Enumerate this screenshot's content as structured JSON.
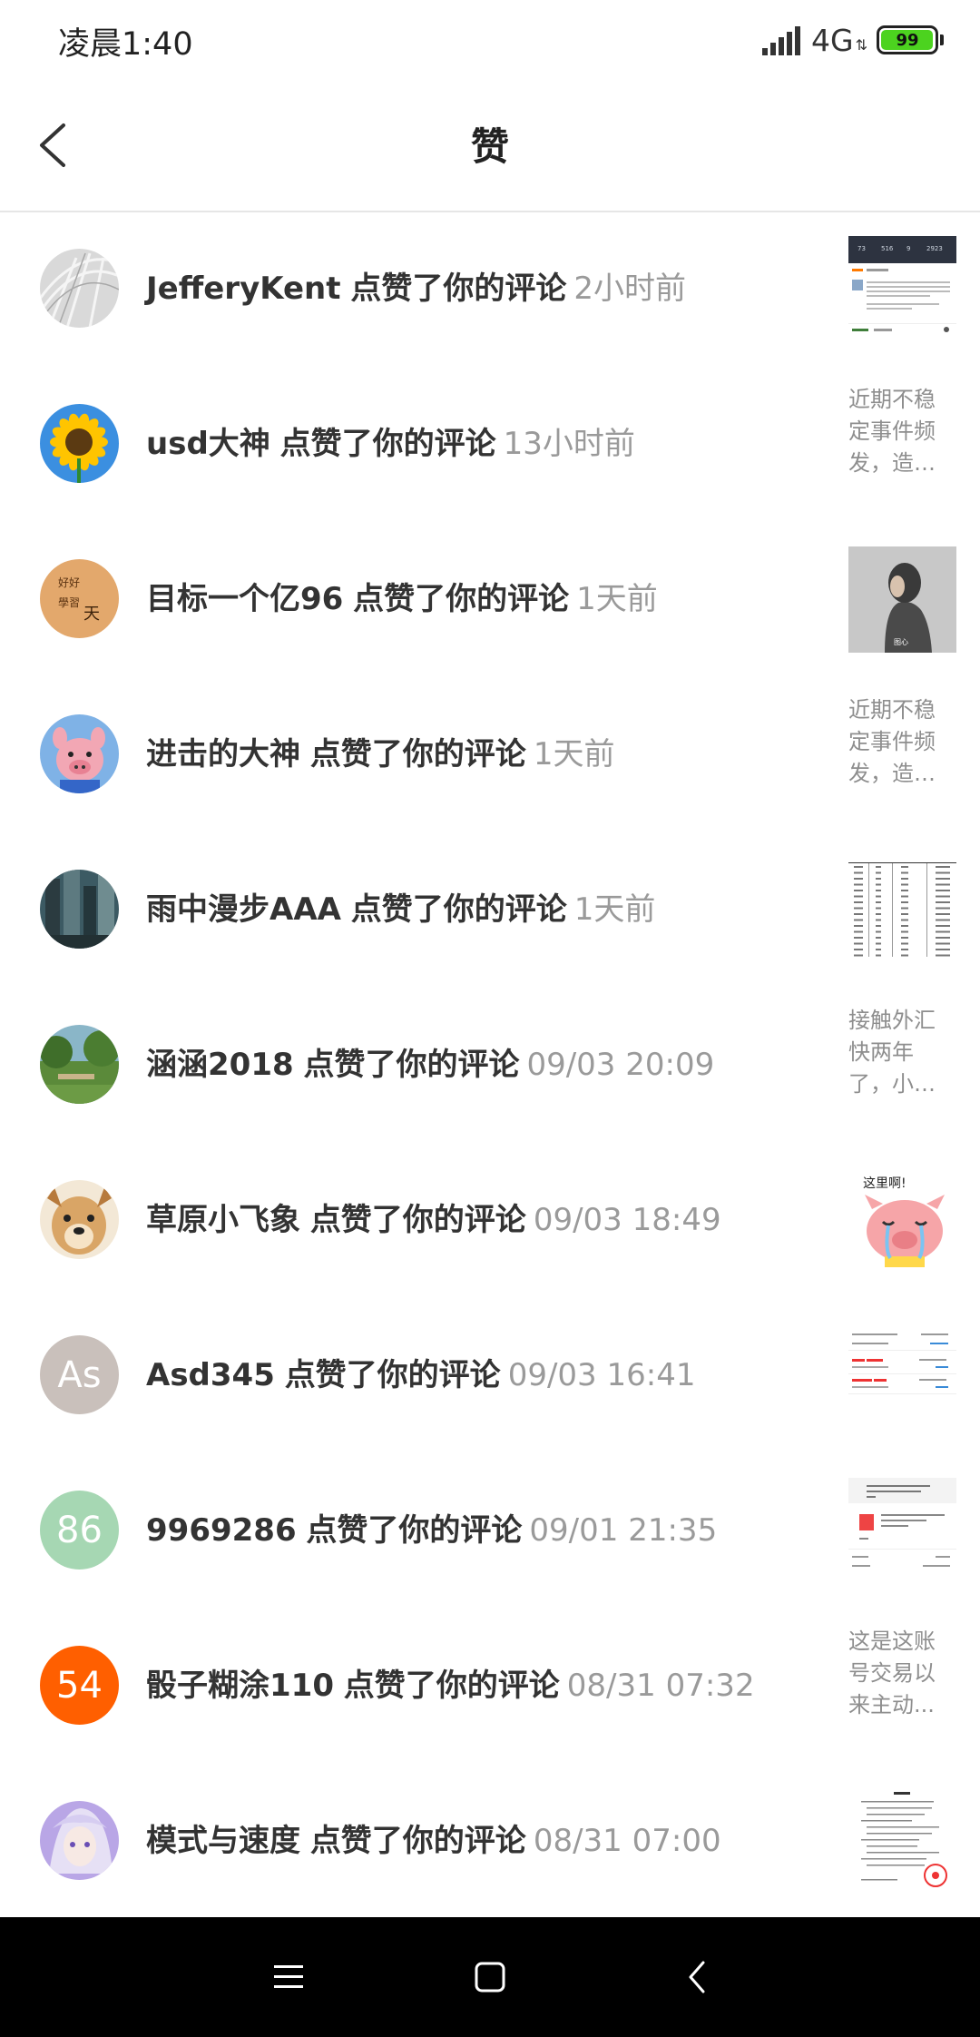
{
  "status_bar": {
    "time": "凌晨1:40",
    "network": "4G",
    "battery": "99",
    "battery_level_percent": 99,
    "battery_color": "#4cd31f"
  },
  "header": {
    "title": "赞",
    "back_icon": "chevron-left-icon"
  },
  "likes": [
    {
      "name": "JefferyKent",
      "action": "点赞了你的评论",
      "time": "2小时前",
      "avatar": {
        "kind": "image",
        "subject": "white structure photo"
      },
      "preview": {
        "kind": "image",
        "subject": "app screenshot"
      }
    },
    {
      "name": "usd大神",
      "action": "点赞了你的评论",
      "time": "13小时前",
      "avatar": {
        "kind": "image",
        "subject": "sunflower"
      },
      "preview": {
        "kind": "text",
        "text": "近期不稳定事件频发，造成..."
      }
    },
    {
      "name": "目标一个亿96",
      "action": "点赞了你的评论",
      "time": "1天前",
      "avatar": {
        "kind": "image",
        "subject": "orange calligraphy"
      },
      "preview": {
        "kind": "image",
        "subject": "person photo"
      }
    },
    {
      "name": "进击的大神",
      "action": "点赞了你的评论",
      "time": "1天前",
      "avatar": {
        "kind": "image",
        "subject": "pink pig toy"
      },
      "preview": {
        "kind": "text",
        "text": "近期不稳定事件频发，造成..."
      }
    },
    {
      "name": "雨中漫步AAA",
      "action": "点赞了你的评论",
      "time": "1天前",
      "avatar": {
        "kind": "image",
        "subject": "city skyscrapers"
      },
      "preview": {
        "kind": "image",
        "subject": "table of numbers"
      }
    },
    {
      "name": "涵涵2018",
      "action": "点赞了你的评论",
      "time": "09/03 20:09",
      "avatar": {
        "kind": "image",
        "subject": "park with trees"
      },
      "preview": {
        "kind": "text",
        "text": "接触外汇快两年了，小白..."
      }
    },
    {
      "name": "草原小飞象",
      "action": "点赞了你的评论",
      "time": "09/03 18:49",
      "avatar": {
        "kind": "image",
        "subject": "dog face"
      },
      "preview": {
        "kind": "image",
        "subject": "crying pig sticker"
      }
    },
    {
      "name": "Asd345",
      "action": "点赞了你的评论",
      "time": "09/03 16:41",
      "avatar": {
        "kind": "text",
        "text": "As",
        "color": "#c9c0bb"
      },
      "preview": {
        "kind": "image",
        "subject": "list screenshot"
      }
    },
    {
      "name": "9969286",
      "action": "点赞了你的评论",
      "time": "09/01 21:35",
      "avatar": {
        "kind": "text",
        "text": "86",
        "color": "#a6d7b3"
      },
      "preview": {
        "kind": "image",
        "subject": "document screenshot"
      }
    },
    {
      "name": "骰子糊涂110",
      "action": "点赞了你的评论",
      "time": "08/31 07:32",
      "avatar": {
        "kind": "text",
        "text": "54",
        "color": "#ff5f00"
      },
      "preview": {
        "kind": "text",
        "text": "这是这账号交易以来主动..."
      }
    },
    {
      "name": "模式与速度",
      "action": "点赞了你的评论",
      "time": "08/31 07:00",
      "avatar": {
        "kind": "image",
        "subject": "anime character purple"
      },
      "preview": {
        "kind": "image",
        "subject": "letter document with red seal"
      }
    }
  ],
  "nav_bar": {
    "menu_icon": "menu-icon",
    "home_icon": "home-square-icon",
    "back_icon": "back-triangle-icon"
  }
}
